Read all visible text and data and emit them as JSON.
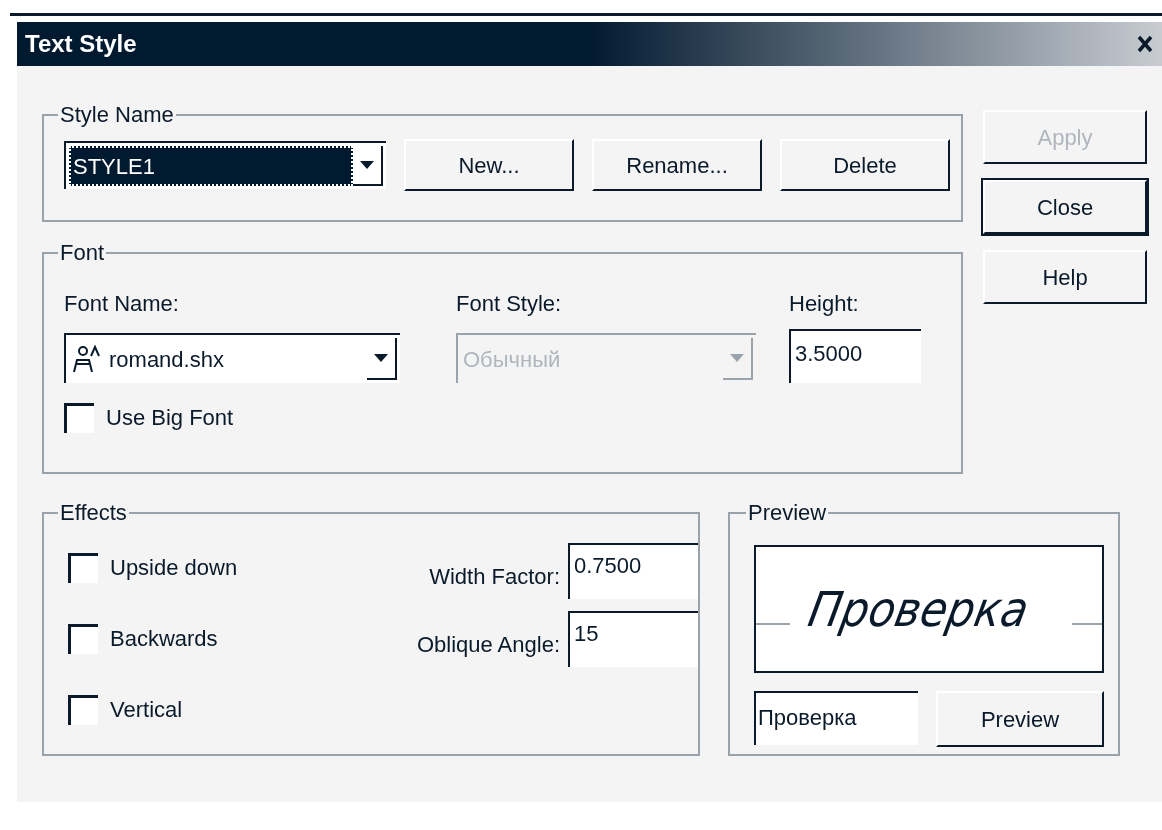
{
  "window": {
    "title": "Text Style"
  },
  "style_name": {
    "label": "Style Name",
    "value": "STYLE1",
    "selected": true,
    "buttons": [
      {
        "label": "New..."
      },
      {
        "label": "Rename..."
      },
      {
        "label": "Delete"
      }
    ]
  },
  "side_buttons": [
    {
      "label": "Apply",
      "disabled": true,
      "default": false
    },
    {
      "label": "Close",
      "disabled": false,
      "default": true
    },
    {
      "label": "Help",
      "disabled": false,
      "default": false
    }
  ],
  "font": {
    "label": "Font",
    "font_name": {
      "label": "Font Name:",
      "value": "romand.shx"
    },
    "font_style": {
      "label": "Font Style:",
      "value": "Обычный",
      "disabled": true
    },
    "height": {
      "label": "Height:",
      "value": "3.5000"
    },
    "use_big_font": {
      "label": "Use Big Font",
      "checked": false
    }
  },
  "effects": {
    "label": "Effects",
    "checkboxes": [
      {
        "label": "Upside down",
        "checked": false
      },
      {
        "label": "Backwards",
        "checked": false
      },
      {
        "label": "Vertical",
        "checked": false
      }
    ],
    "fields": [
      {
        "label": "Width Factor:",
        "value": "0.7500"
      },
      {
        "label": "Oblique Angle:",
        "value": "15"
      }
    ]
  },
  "preview": {
    "label": "Preview",
    "sample": "Проверка",
    "input": "Проверка",
    "button": "Preview"
  }
}
